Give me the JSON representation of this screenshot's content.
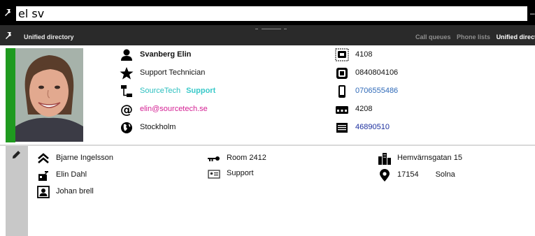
{
  "search": {
    "value": "el sv"
  },
  "toolbar": {
    "title": "Unified directory",
    "tabs": [
      {
        "label": "Call queues",
        "active": false
      },
      {
        "label": "Phone lists",
        "active": false
      },
      {
        "label": "Unified directo",
        "active": true
      }
    ]
  },
  "contact": {
    "name": "Svanberg Elin",
    "title": "Support Technician",
    "company": "SourceTech",
    "department": "Support",
    "email": "elin@sourcetech.se",
    "location": "Stockholm",
    "status_color": "#1f9a1f",
    "phones": {
      "extension": "4108",
      "office": "0840804106",
      "mobile": "0706555486",
      "switchboard": "4208",
      "fax": "46890510"
    }
  },
  "details": {
    "manager": "Bjarne Ingelsson",
    "assistant": "Elin Dahl",
    "colleague": "Johan brell",
    "room": "Room 2412",
    "group": "Support",
    "street": "Hemvärnsgatan 15",
    "postal_code": "17154",
    "city": "Solna"
  },
  "colors": {
    "link_blue": "#2f6ab8",
    "link_navy": "#1c2f9e",
    "email_pink": "#d41f93",
    "company_teal": "#2bbfbf"
  }
}
